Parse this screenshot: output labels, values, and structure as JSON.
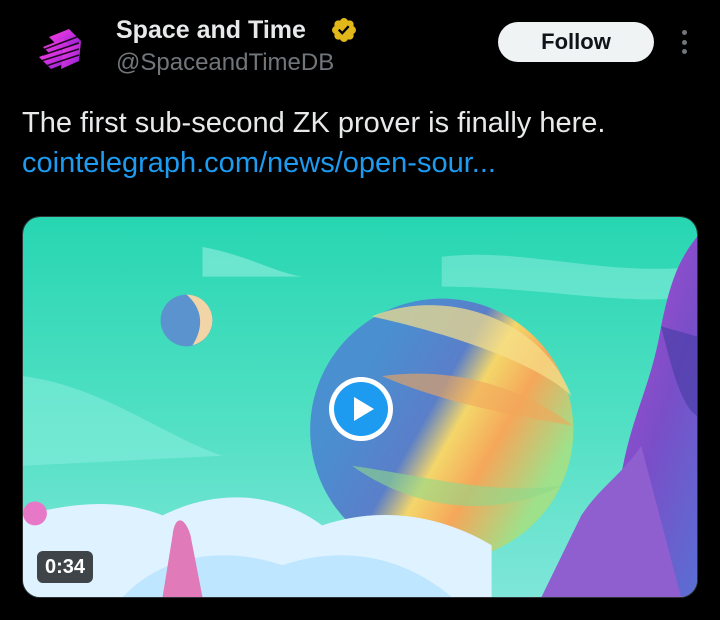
{
  "author": {
    "display_name": "Space and Time",
    "handle": "@SpaceandTimeDB",
    "verified": true,
    "badge_color": "#e2b719",
    "avatar_colors": [
      "#ff2bd6",
      "#7a1fd1"
    ]
  },
  "actions": {
    "follow_label": "Follow",
    "more_icon": "more-vertical-icon"
  },
  "tweet": {
    "text": "The first sub-second ZK prover is finally here.",
    "link_text": "cointelegraph.com/news/open-sour..."
  },
  "media": {
    "type": "video",
    "duration": "0:34",
    "play_icon": "play-icon",
    "accent_color": "#1d9bf0"
  },
  "theme": {
    "background": "#000000",
    "text_primary": "#e7e9ea",
    "text_secondary": "#71767b",
    "link": "#1d9bf0"
  }
}
